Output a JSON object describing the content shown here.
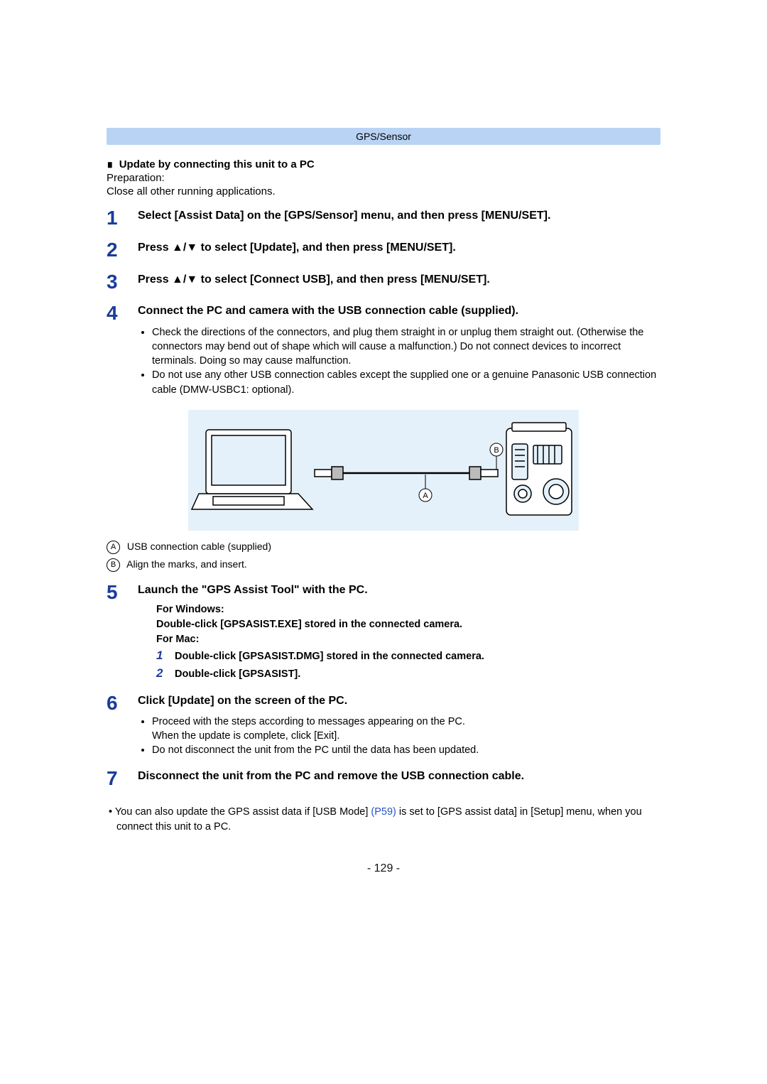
{
  "header": "GPS/Sensor",
  "section": {
    "title": "Update by connecting this unit to a PC",
    "prep1": "Preparation:",
    "prep2": "Close all other running applications."
  },
  "steps": {
    "s1": {
      "n": "1",
      "text": "Select [Assist Data] on the [GPS/Sensor] menu, and then press [MENU/SET]."
    },
    "s2": {
      "n": "2",
      "text_before": "Press ",
      "text_after": " to select [Update], and then press [MENU/SET]."
    },
    "s3": {
      "n": "3",
      "text_before": "Press ",
      "text_after": " to select [Connect USB], and then press [MENU/SET]."
    },
    "s4": {
      "n": "4",
      "text": "Connect the PC and camera with the USB connection cable (supplied).",
      "bullets": [
        "Check the directions of the connectors, and plug them straight in or unplug them straight out. (Otherwise the connectors may bend out of shape which will cause a malfunction.) Do not connect devices to incorrect terminals. Doing so may cause malfunction.",
        "Do not use any other USB connection cables except the supplied one or a genuine Panasonic USB connection cable (DMW-USBC1: optional)."
      ]
    },
    "s5": {
      "n": "5",
      "text": "Launch the \"GPS Assist Tool\" with the PC.",
      "win_label": "For Windows:",
      "win_text": "Double-click [GPSASIST.EXE] stored in the connected camera.",
      "mac_label": "For Mac:",
      "mac_sub1": "Double-click [GPSASIST.DMG] stored in the connected camera.",
      "mac_sub2": "Double-click [GPSASIST]."
    },
    "s6": {
      "n": "6",
      "text": "Click [Update] on the screen of the PC.",
      "b1": "Proceed with the steps according to messages appearing on the PC.",
      "b1_sub": "When the update is complete, click [Exit].",
      "b2": "Do not disconnect the unit from the PC until the data has been updated."
    },
    "s7": {
      "n": "7",
      "text": "Disconnect the unit from the PC and remove the USB connection cable."
    }
  },
  "figure": {
    "A": "A",
    "B": "B",
    "capA": "USB connection cable (supplied)",
    "capB": "Align the marks, and insert."
  },
  "footnote": {
    "pre": "You can also update the GPS assist data if [USB Mode] ",
    "link": "(P59)",
    "post": " is set to [GPS assist data] in [Setup] menu, when you connect this unit to a PC."
  },
  "pageNumber": "- 129 -"
}
